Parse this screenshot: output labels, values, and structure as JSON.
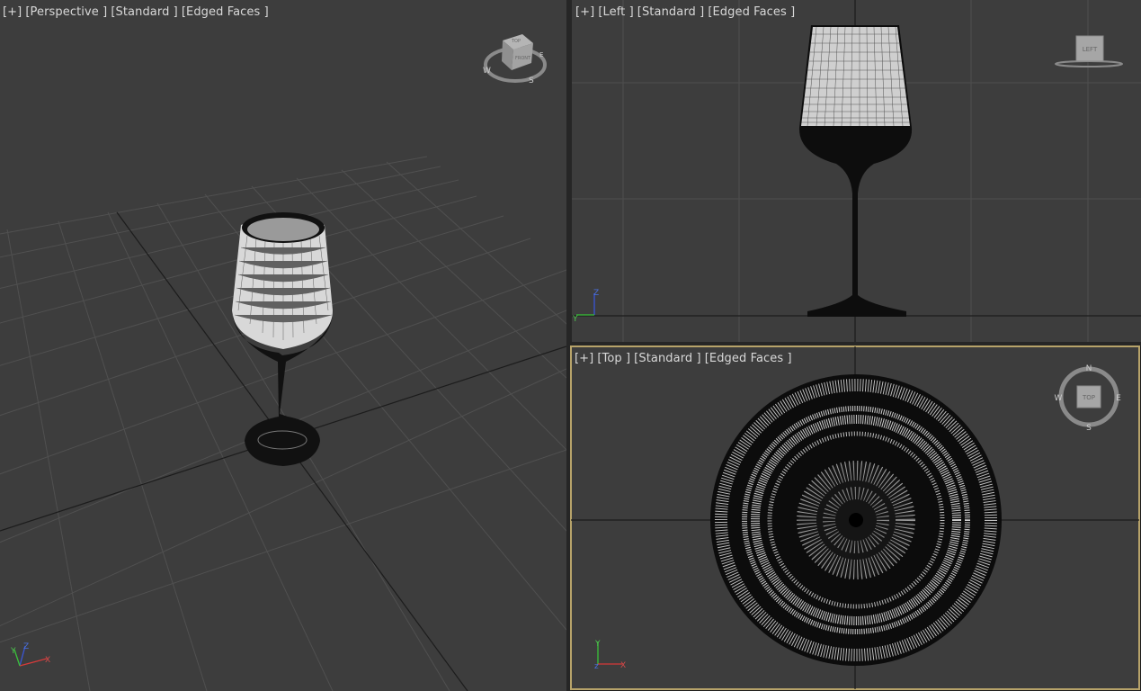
{
  "viewports": {
    "perspective": {
      "label": [
        "[+]",
        "[Perspective ]",
        "[Standard ]",
        "[Edged Faces ]"
      ],
      "viewcube": {
        "top": "TOP",
        "front": "FRONT",
        "compass": [
          "W",
          "S",
          "E"
        ]
      },
      "axes": [
        "Z",
        "Y",
        "X"
      ]
    },
    "left": {
      "label": [
        "[+]",
        "[Left ]",
        "[Standard ]",
        "[Edged Faces ]"
      ],
      "viewcube": {
        "face": "LEFT"
      },
      "axes": [
        "Z",
        "Y"
      ]
    },
    "top": {
      "label": [
        "[+]",
        "[Top ]",
        "[Standard ]",
        "[Edged Faces ]"
      ],
      "viewcube": {
        "face": "TOP",
        "compass": [
          "N",
          "S",
          "W",
          "E"
        ]
      },
      "axes": [
        "Y",
        "X"
      ],
      "active": true
    }
  },
  "colors": {
    "viewport_bg": "#3d3d3d",
    "grid": "#4e4e4e",
    "active_border": "#b7a36a",
    "mesh": "#000000"
  }
}
